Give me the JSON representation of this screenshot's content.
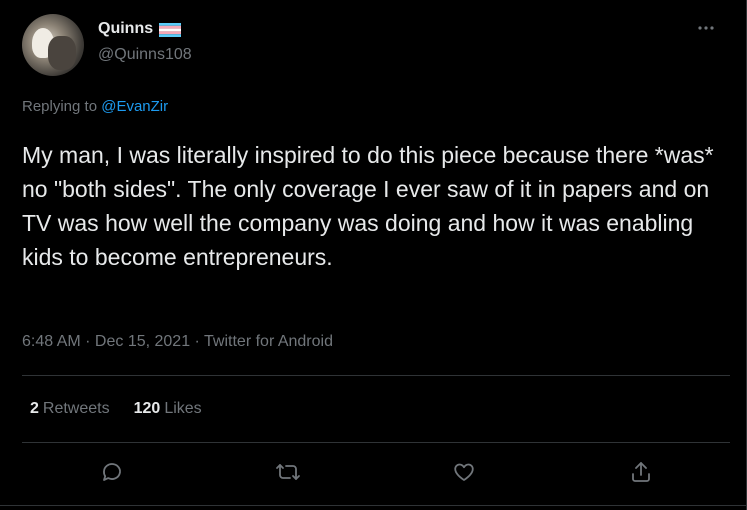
{
  "author": {
    "display_name": "Quinns",
    "handle": "@Quinns108",
    "flag_icon": "trans-flag-icon"
  },
  "reply": {
    "prefix": "Replying to ",
    "mention": "@EvanZir"
  },
  "tweet": {
    "text": "My man, I was literally inspired to do this piece because there *was* no \"both sides\". The only coverage I ever saw of it in papers and on TV was how well the company was doing and how it was enabling kids to become entrepreneurs.",
    "meta": "6:48 AM · Dec 15, 2021 · Twitter for Android"
  },
  "stats": {
    "retweets_count": "2",
    "retweets_label": "Retweets",
    "likes_count": "120",
    "likes_label": "Likes"
  },
  "actions": {
    "reply_icon": "reply-icon",
    "retweet_icon": "retweet-icon",
    "like_icon": "heart-icon",
    "share_icon": "share-icon",
    "more_icon": "more-icon"
  },
  "colors": {
    "background": "#000000",
    "text": "#e7e9ea",
    "muted": "#71767b",
    "accent": "#1d9bf0",
    "divider": "#2f3336"
  }
}
